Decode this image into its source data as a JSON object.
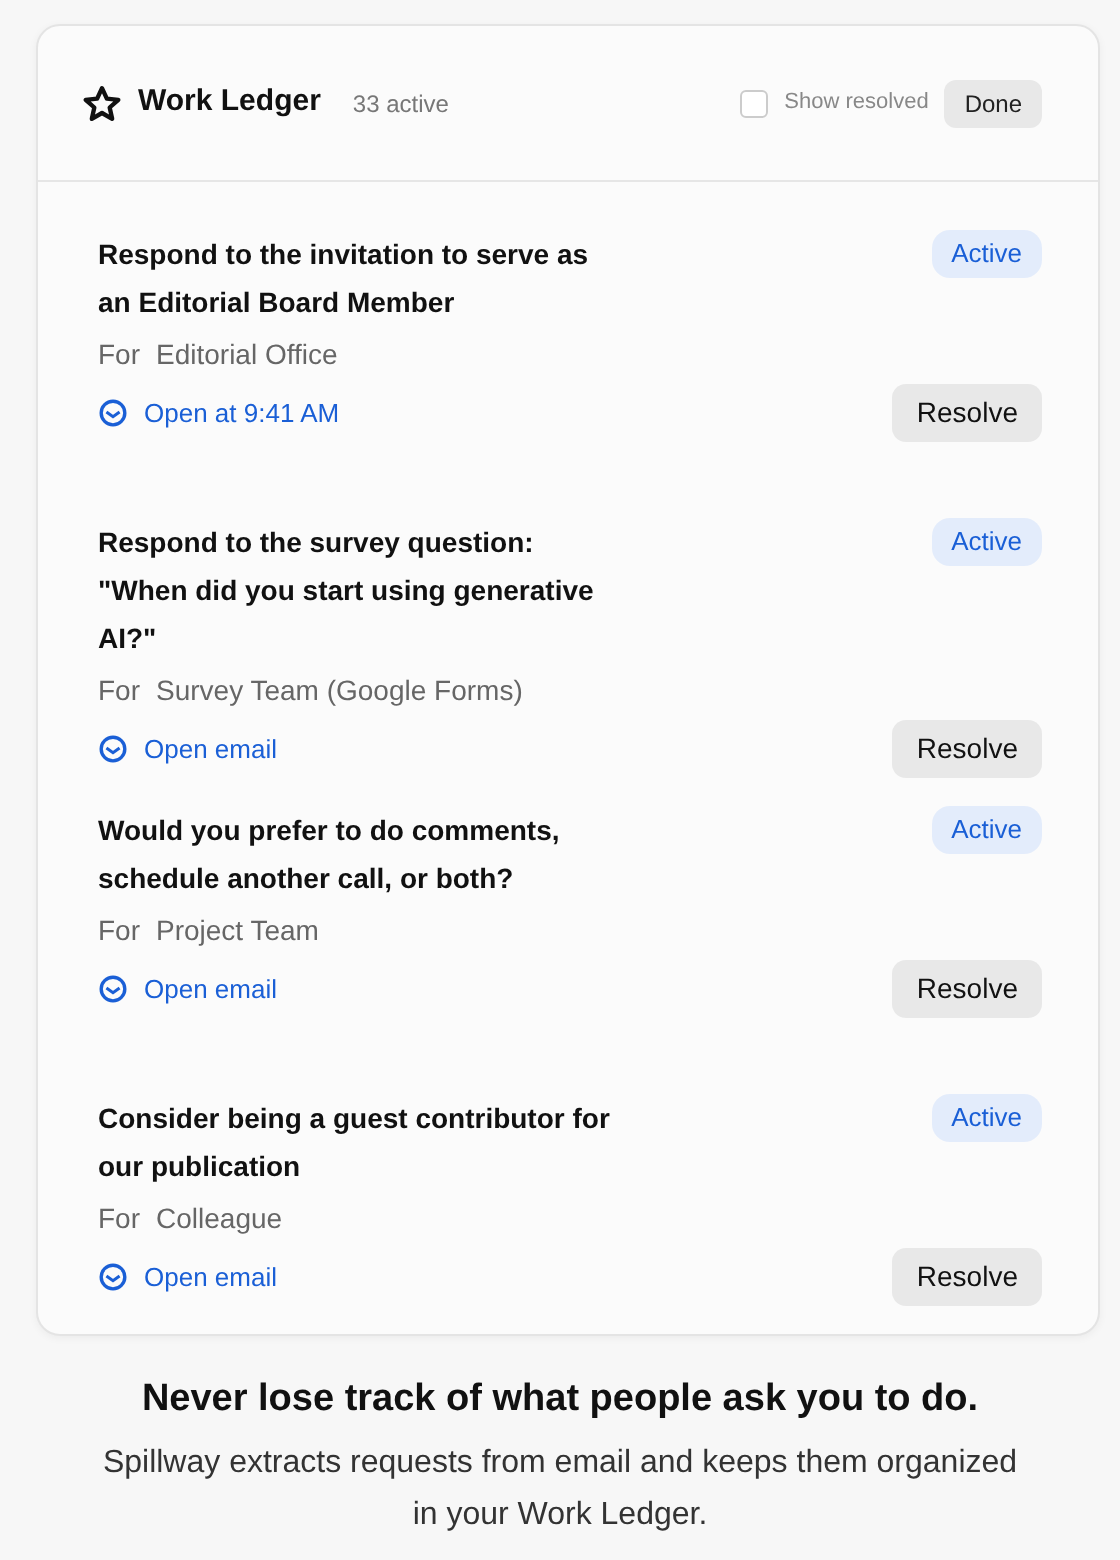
{
  "header": {
    "title": "Work Ledger",
    "count": "33 active",
    "show_resolved": {
      "label": "Show resolved",
      "checked": false
    },
    "done_button": "Done"
  },
  "items": [
    {
      "title": "Respond to the invitation to serve as an Editorial Board Member",
      "status": "Active",
      "for_label": "For",
      "for": "Editorial Office",
      "link": "Open at 9:41 AM",
      "action": "Resolve"
    },
    {
      "title": "Respond to the survey question: \"When did you start using generative AI?\"",
      "status": "Active",
      "for_label": "For",
      "for": "Survey Team (Google Forms)",
      "link": "Open email",
      "action": "Resolve"
    },
    {
      "title": "Would you prefer to do comments, schedule another call, or both?",
      "status": "Active",
      "for_label": "For",
      "for": "Project Team",
      "link": "Open email",
      "action": "Resolve"
    },
    {
      "title": "Consider being a guest contributor for our publication",
      "status": "Active",
      "for_label": "For",
      "for": "Colleague",
      "link": "Open email",
      "action": "Resolve"
    }
  ],
  "footer": {
    "headline": "Never lose track of what people ask you to do.",
    "text": "Spillway extracts requests from email and keeps them organized in your Work Ledger."
  }
}
